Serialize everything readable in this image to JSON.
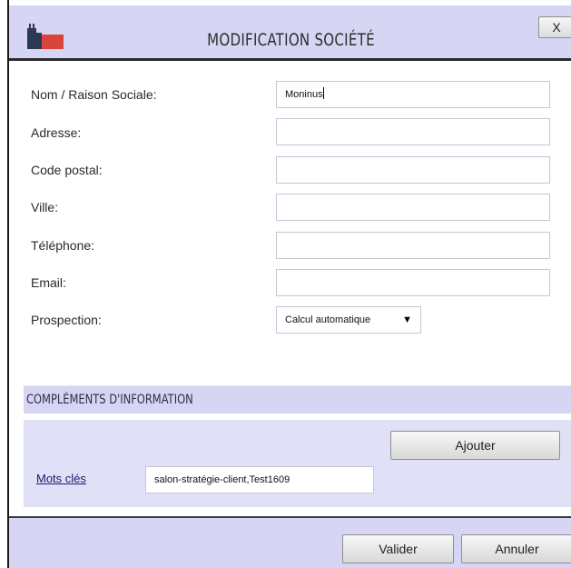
{
  "dialog": {
    "title": "MODIFICATION SOCIÉTÉ",
    "close_label": "X",
    "logo_icon": "building-icon"
  },
  "form": {
    "fields": [
      {
        "label": "Nom / Raison Sociale:",
        "value": "Moninus"
      },
      {
        "label": "Adresse:",
        "value": ""
      },
      {
        "label": "Code postal:",
        "value": ""
      },
      {
        "label": "Ville:",
        "value": ""
      },
      {
        "label": "Téléphone:",
        "value": ""
      },
      {
        "label": "Email:",
        "value": ""
      }
    ],
    "prospection": {
      "label": "Prospection:",
      "selected": "Calcul automatique",
      "arrow": "▼"
    }
  },
  "complements": {
    "title": "COMPLÉMENTS D'INFORMATION",
    "add_label": "Ajouter",
    "keywords_label": "Mots clés",
    "keywords_value": "salon-stratégie-client,Test1609"
  },
  "footer": {
    "validate_label": "Valider",
    "cancel_label": "Annuler"
  },
  "colors": {
    "header_bg": "#d6d6f4",
    "section_bg": "#e0e0f6",
    "logo_dark": "#2b3a52",
    "logo_red": "#d9453a"
  }
}
